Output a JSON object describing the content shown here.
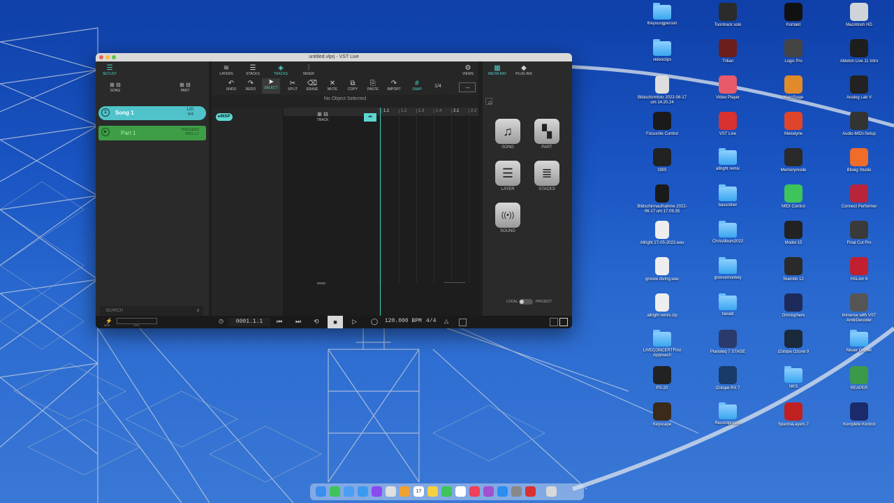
{
  "window": {
    "title": "untitled.vlprj - VST Live",
    "setlist_label": "SETLIST",
    "song_label": "SONG",
    "part_label": "PART",
    "tools_top": [
      "LAYERS",
      "STACKS",
      "TRACKS",
      "MIXER"
    ],
    "views_label": "VIEWS",
    "tools_bottom": [
      "UNDO",
      "REDO",
      "SELECT",
      "SPLIT",
      "ERASE",
      "MUTE",
      "COPY",
      "PASTE",
      "IMPORT",
      "SNAP"
    ],
    "quantize": "1/4",
    "right_tabs": [
      "MEDIA BAY",
      "PLUG-INS"
    ],
    "no_object": "No Object Selected",
    "insp_label": "INSP",
    "track_label": "TRACK",
    "ruler": [
      "1.1",
      "1.2",
      "1.3",
      "1.4",
      "2.1",
      "2.2"
    ],
    "song1": {
      "name": "Song 1",
      "tempo": "120",
      "sig": "4/4"
    },
    "part1": {
      "name": "Part 1",
      "tag": "TRIGGERS",
      "pos": "0001.1.1"
    },
    "search_placeholder": "SEARCH",
    "search_clear": "x",
    "mediabay_tiles": [
      "SONG",
      "PART",
      "LAYER",
      "STACKS",
      "SOUND"
    ],
    "local_label": "LOCAL",
    "project_label": "PROJECT",
    "midi_label": "MIDI",
    "cpu_label": "CPU",
    "position": "0001.1.1",
    "tempo": "120.000 BPM",
    "signature": "4/4"
  },
  "desktop": {
    "icons": [
      {
        "label": "theyoungperson",
        "type": "folder",
        "color": "#4ab0f5"
      },
      {
        "label": "Toontrack solo",
        "type": "app",
        "color": "#2b2b2b"
      },
      {
        "label": "Kontakt",
        "type": "app",
        "color": "#111111"
      },
      {
        "label": "Macintosh HD",
        "type": "app",
        "color": "#cfd4d8"
      },
      {
        "label": "videoclips",
        "type": "folder",
        "color": "#4ab0f5"
      },
      {
        "label": "Trilian",
        "type": "app",
        "color": "#6b1e1e"
      },
      {
        "label": "Logic Pro",
        "type": "app",
        "color": "#444444"
      },
      {
        "label": "Ableton Live 11 Intro",
        "type": "app",
        "color": "#1e1e1e"
      },
      {
        "label": "Bildschirmfoto 2022-06-17 um 14.20.24",
        "type": "file",
        "color": "#dddddd"
      },
      {
        "label": "Video Player",
        "type": "app",
        "color": "#e85a6a"
      },
      {
        "label": "MainStage",
        "type": "app",
        "color": "#e08a2a"
      },
      {
        "label": "Analog Lab V",
        "type": "app",
        "color": "#222222"
      },
      {
        "label": "Focusrite Control",
        "type": "app",
        "color": "#1a1a1a"
      },
      {
        "label": "VST Live",
        "type": "app",
        "color": "#d93030"
      },
      {
        "label": "Melodyne",
        "type": "app",
        "color": "#e0442a"
      },
      {
        "label": "Audio-MIDI-Setup",
        "type": "app",
        "color": "#333333"
      },
      {
        "label": "OBS",
        "type": "app",
        "color": "#222222"
      },
      {
        "label": "allright remix",
        "type": "folder",
        "color": "#4ab0f5"
      },
      {
        "label": "Memorymode",
        "type": "app",
        "color": "#2a2a2a"
      },
      {
        "label": "Bitwig Studio",
        "type": "app",
        "color": "#ef6c2a"
      },
      {
        "label": "Bildschirmaufnahme 2022-06-17 um 17.09.35",
        "type": "file",
        "color": "#1a1a1a"
      },
      {
        "label": "bassrdner",
        "type": "folder",
        "color": "#4ab0f5"
      },
      {
        "label": "MIDI Control",
        "type": "app",
        "color": "#3ec45a"
      },
      {
        "label": "Connect Performer",
        "type": "app",
        "color": "#b8243a"
      },
      {
        "label": "Allright 27-05-2022.wav",
        "type": "file",
        "color": "#eeeeee"
      },
      {
        "label": "ChrisAlbum2022",
        "type": "folder",
        "color": "#4ab0f5"
      },
      {
        "label": "Model 15",
        "type": "app",
        "color": "#222222"
      },
      {
        "label": "Final Cut Pro",
        "type": "app",
        "color": "#3a3a3a"
      },
      {
        "label": "groove diving.wav",
        "type": "file",
        "color": "#eeeeee"
      },
      {
        "label": "groovemonkey",
        "type": "folder",
        "color": "#4ab0f5"
      },
      {
        "label": "Nuendo 12",
        "type": "app",
        "color": "#2a2a2a"
      },
      {
        "label": "HALion 6",
        "type": "app",
        "color": "#c02030"
      },
      {
        "label": "allright remix.zip",
        "type": "file",
        "color": "#eeeeee"
      },
      {
        "label": "harald",
        "type": "folder",
        "color": "#4ab0f5"
      },
      {
        "label": "Omnisphere",
        "type": "app",
        "color": "#1e2a5a"
      },
      {
        "label": "Immerse with VST AmbiDecoder",
        "type": "app",
        "color": "#555555"
      },
      {
        "label": "LIVECONCERTFirst Approach",
        "type": "folder",
        "color": "#4ab0f5"
      },
      {
        "label": "Pianoteq 7 STAGE",
        "type": "app",
        "color": "#2a3a6a"
      },
      {
        "label": "iZotope Ozone 9",
        "type": "app",
        "color": "#1a2a3a"
      },
      {
        "label": "Neuer Ordner",
        "type": "folder",
        "color": "#4ab0f5"
      },
      {
        "label": "PS-20",
        "type": "app",
        "color": "#222222"
      },
      {
        "label": "iZotope RX 7",
        "type": "app",
        "color": "#1a3a6a"
      },
      {
        "label": "NKS",
        "type": "folder",
        "color": "#4ab0f5"
      },
      {
        "label": "REAPER",
        "type": "app",
        "color": "#3a9a4a"
      },
      {
        "label": "Keyscape",
        "type": "app",
        "color": "#3a2a1a"
      },
      {
        "label": "Recordprojekt",
        "type": "folder",
        "color": "#4ab0f5"
      },
      {
        "label": "SpectraLayers 7",
        "type": "app",
        "color": "#c02020"
      },
      {
        "label": "Komplete Kontrol",
        "type": "app",
        "color": "#1a2a6a"
      }
    ]
  },
  "dock": {
    "items": [
      "Finder",
      "Messages",
      "Mail",
      "Safari",
      "Messenger",
      "Chrome",
      "Photos",
      "Calendar",
      "Notes",
      "WhatsApp",
      "Reminders",
      "Music",
      "Podcasts",
      "App Store",
      "Settings",
      "VST Live",
      "Trash"
    ],
    "calendar_day": "17"
  }
}
